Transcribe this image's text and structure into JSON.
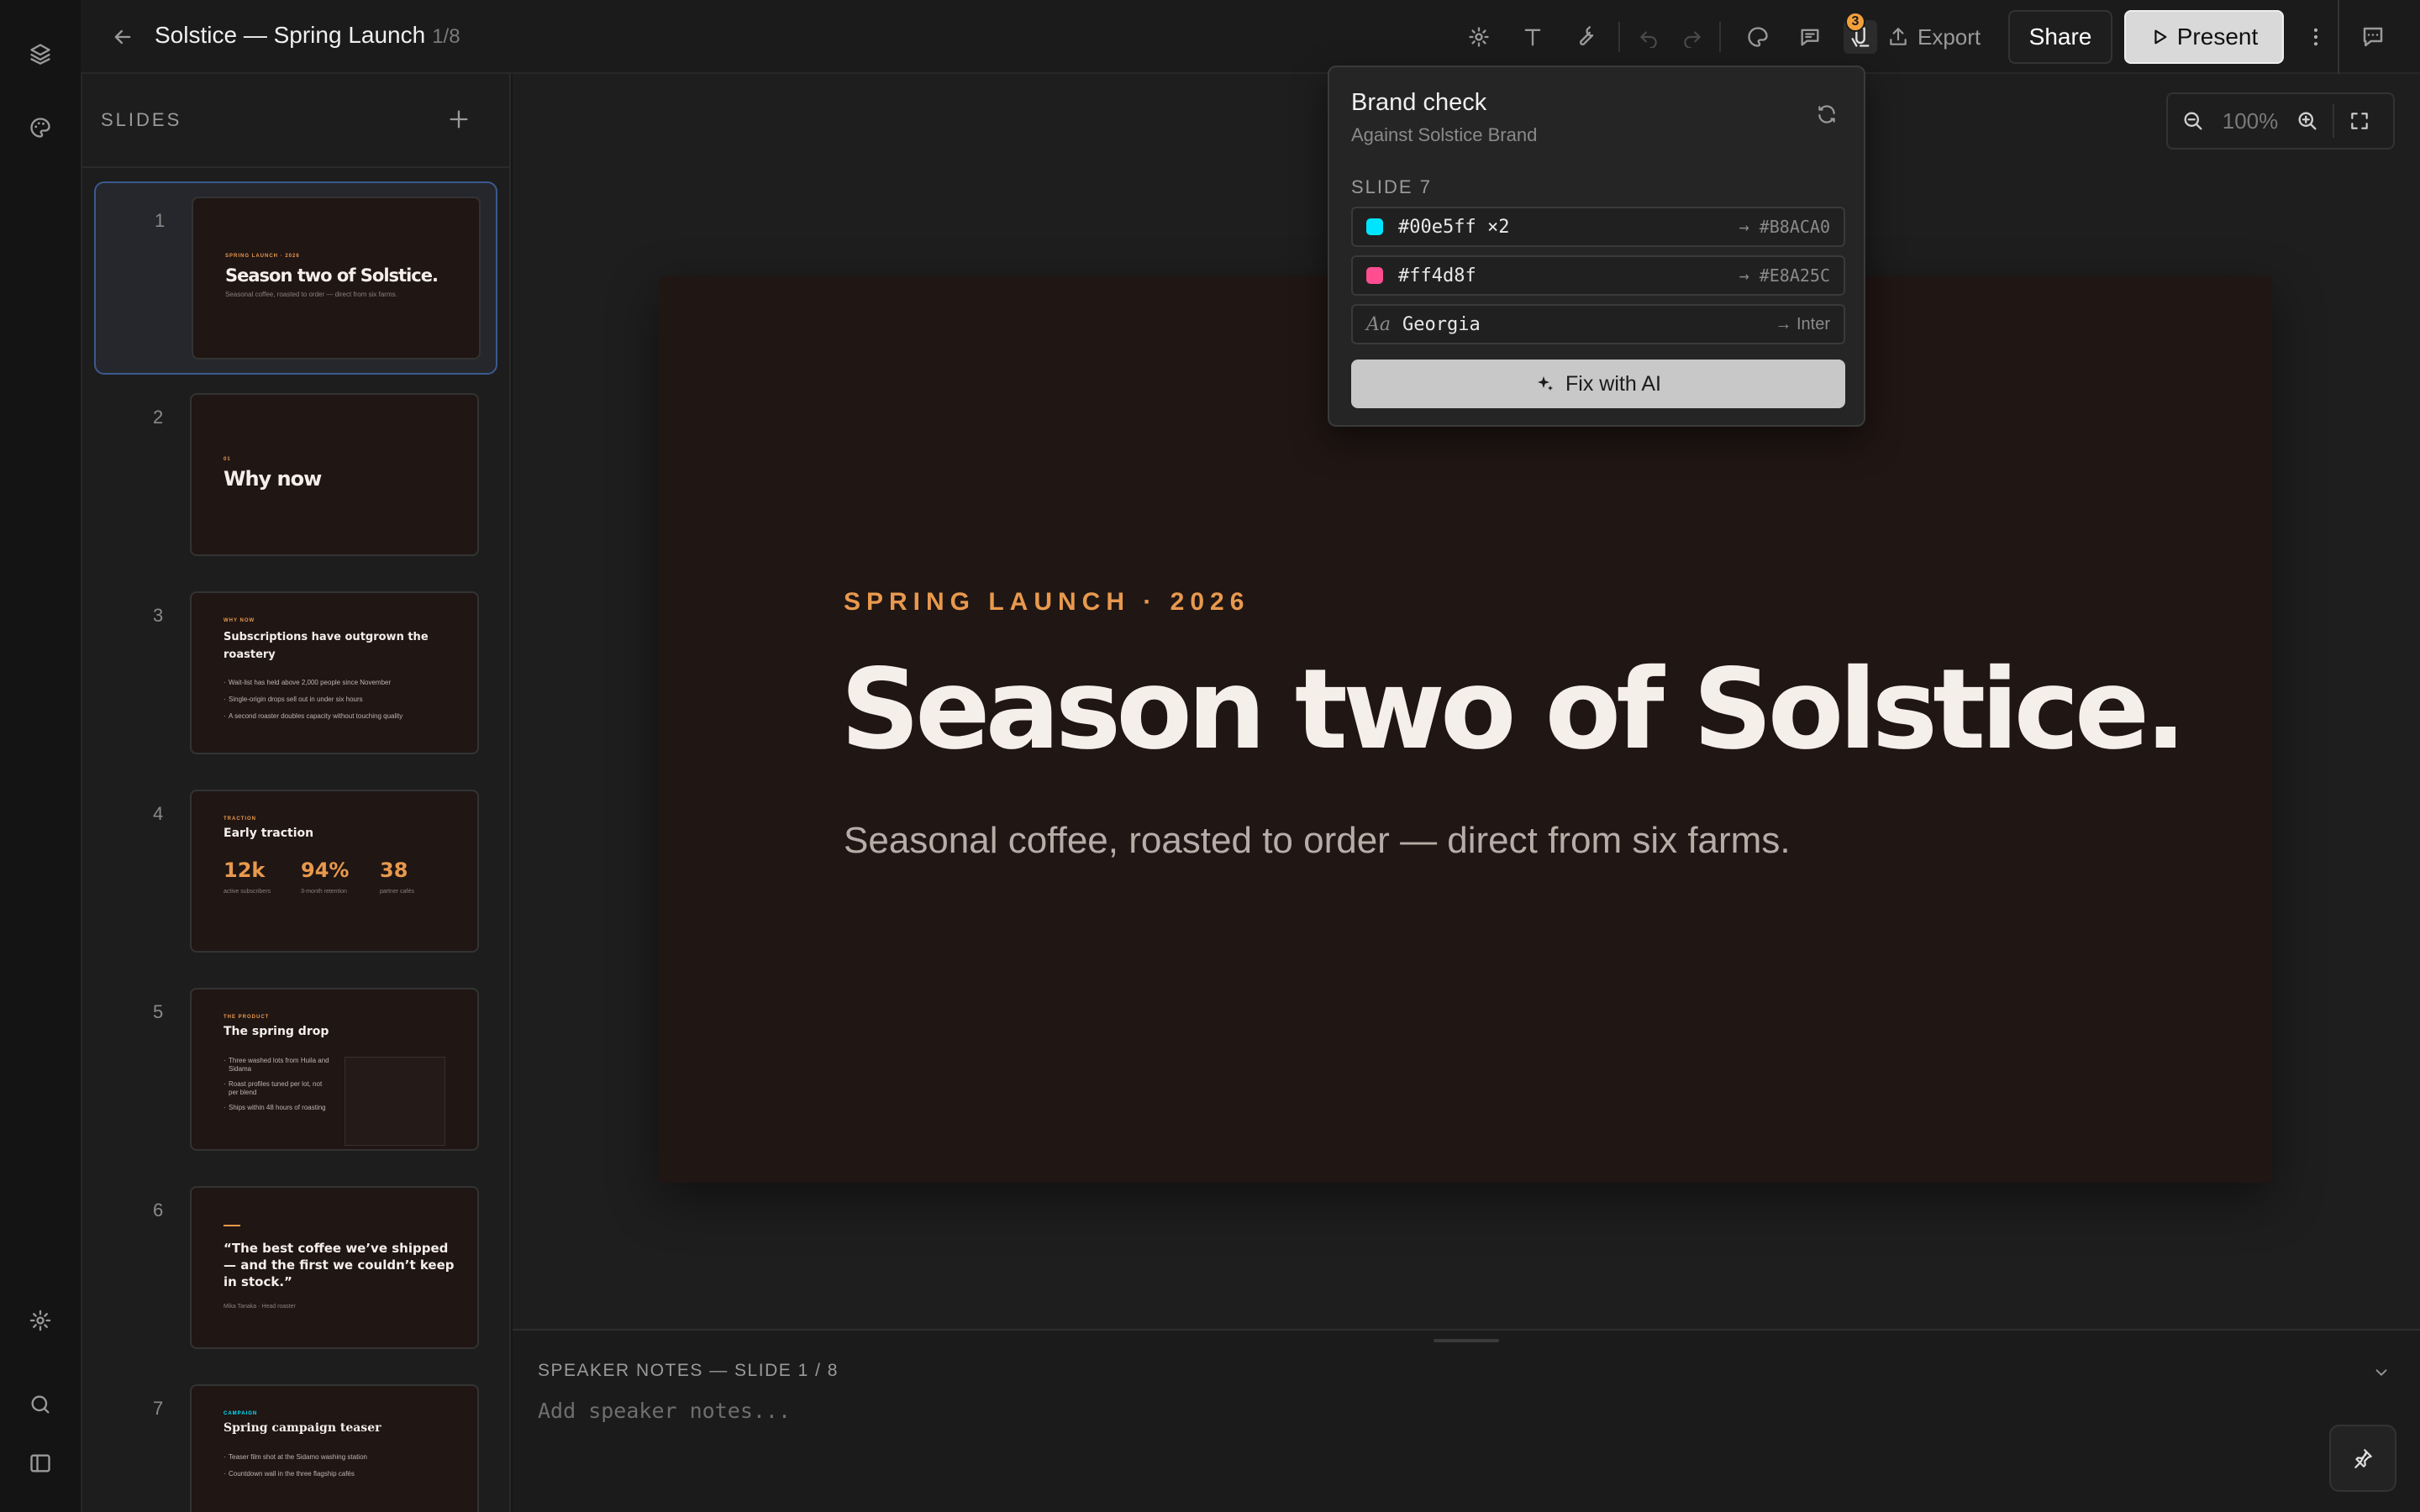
{
  "app": {
    "title": "Solstice — Spring Launch",
    "page_indicator": "1/8"
  },
  "toolbar": {
    "icons": [
      "settings-icon",
      "text-icon",
      "wrench-icon",
      "undo-icon",
      "redo-icon",
      "palette-icon",
      "comment-icon",
      "brand-check-icon"
    ],
    "brand_check_badge": "3",
    "export_label": "Export",
    "share_label": "Share",
    "present_label": "Present"
  },
  "rail": {
    "icons": [
      "layers-icon",
      "palette-icon",
      "settings-icon",
      "search-icon",
      "sidebar-toggle-icon"
    ]
  },
  "slides_panel": {
    "title": "SLIDES",
    "slides": [
      {
        "num": "1",
        "eyebrow": "SPRING LAUNCH · 2026",
        "title": "Season two of Solstice.",
        "sub": "Seasonal coffee, roasted to order — direct from six farms."
      },
      {
        "num": "2",
        "eyebrow": "01",
        "title": "Why now"
      },
      {
        "num": "3",
        "eyebrow": "WHY NOW",
        "title": "Subscriptions have outgrown the roastery",
        "bullets": [
          "Wait-list has held above 2,000 people since November",
          "Single-origin drops sell out in under six hours",
          "A second roaster doubles capacity without touching quality"
        ]
      },
      {
        "num": "4",
        "eyebrow": "TRACTION",
        "title": "Early traction",
        "stats": [
          {
            "v": "12k",
            "l": "active subscribers"
          },
          {
            "v": "94%",
            "l": "3-month retention"
          },
          {
            "v": "38",
            "l": "partner cafés"
          }
        ]
      },
      {
        "num": "5",
        "eyebrow": "THE PRODUCT",
        "title": "The spring drop",
        "bullets": [
          "Three washed lots from Huila and Sidama",
          "Roast profiles tuned per lot, not per blend",
          "Ships within 48 hours of roasting"
        ]
      },
      {
        "num": "6",
        "quote": "“The best coffee we’ve shipped — and the first we couldn’t keep in stock.”",
        "attribution": "Mika Tanaka · Head roaster"
      },
      {
        "num": "7",
        "eyebrow": "CAMPAIGN",
        "title": "Spring campaign teaser",
        "bullets": [
          "Teaser film shot at the Sidamo washing station",
          "Countdown wall in the three flagship cafés"
        ]
      }
    ]
  },
  "zoom": {
    "value": "100%"
  },
  "slide": {
    "eyebrow": "SPRING LAUNCH · 2026",
    "title": "Season two of Solstice.",
    "subtitle": "Seasonal coffee, roasted to order — direct from six farms."
  },
  "brand_check": {
    "title": "Brand check",
    "subtitle": "Against Solstice Brand",
    "section": "SLIDE 7",
    "issues": [
      {
        "value": "#00e5ff ×2",
        "fix": "→ #B8ACA0",
        "swatch": "#00e5ff"
      },
      {
        "value": "#ff4d8f",
        "fix": "→ #E8A25C",
        "swatch": "#ff4d8f"
      },
      {
        "aa": "Aa",
        "value": "Georgia",
        "fix": "→ Inter"
      }
    ],
    "fix_label": "Fix with AI"
  },
  "notes": {
    "title": "SPEAKER NOTES — SLIDE 1 / 8",
    "placeholder": "Add speaker notes..."
  },
  "colors": {
    "accent": "#e8994d",
    "slide_bg": "#201614",
    "selected": "#3a5a8e"
  }
}
